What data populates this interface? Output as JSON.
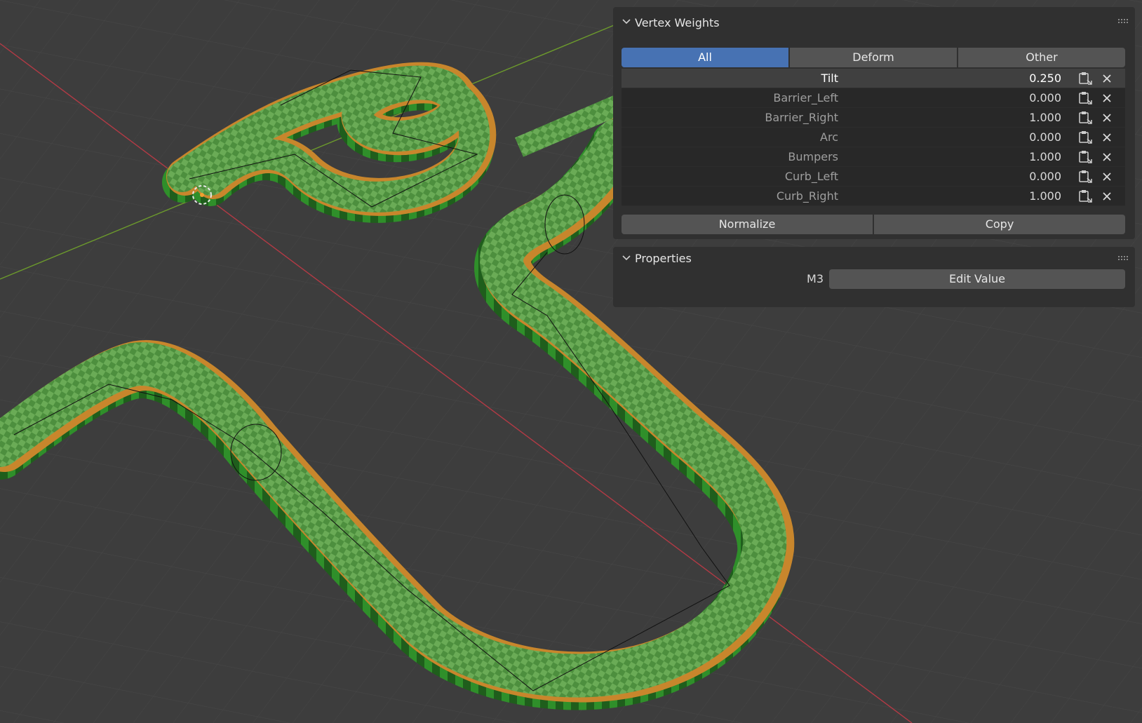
{
  "vertex_weights_panel": {
    "title": "Vertex Weights",
    "tabs": [
      {
        "label": "All",
        "active": true
      },
      {
        "label": "Deform",
        "active": false
      },
      {
        "label": "Other",
        "active": false
      }
    ],
    "rows": [
      {
        "name": "Tilt",
        "value": "0.250",
        "active": true
      },
      {
        "name": "Barrier_Left",
        "value": "0.000",
        "active": false
      },
      {
        "name": "Barrier_Right",
        "value": "1.000",
        "active": false
      },
      {
        "name": "Arc",
        "value": "0.000",
        "active": false
      },
      {
        "name": "Bumpers",
        "value": "1.000",
        "active": false
      },
      {
        "name": "Curb_Left",
        "value": "0.000",
        "active": false
      },
      {
        "name": "Curb_Right",
        "value": "1.000",
        "active": false
      }
    ],
    "normalize_label": "Normalize",
    "copy_label": "Copy",
    "row_icons": [
      "paste-icon",
      "close-icon"
    ]
  },
  "properties_panel": {
    "title": "Properties",
    "field_label": "M3",
    "button_label": "Edit Value"
  },
  "colors": {
    "viewport_bg": "#3d3d3d",
    "panel_bg": "#303030",
    "accent": "#4772b3",
    "x_axis": "#b33a45",
    "y_axis": "#6c9a2c",
    "track_green": "#3f8a2e",
    "track_orange": "#c8862c"
  }
}
